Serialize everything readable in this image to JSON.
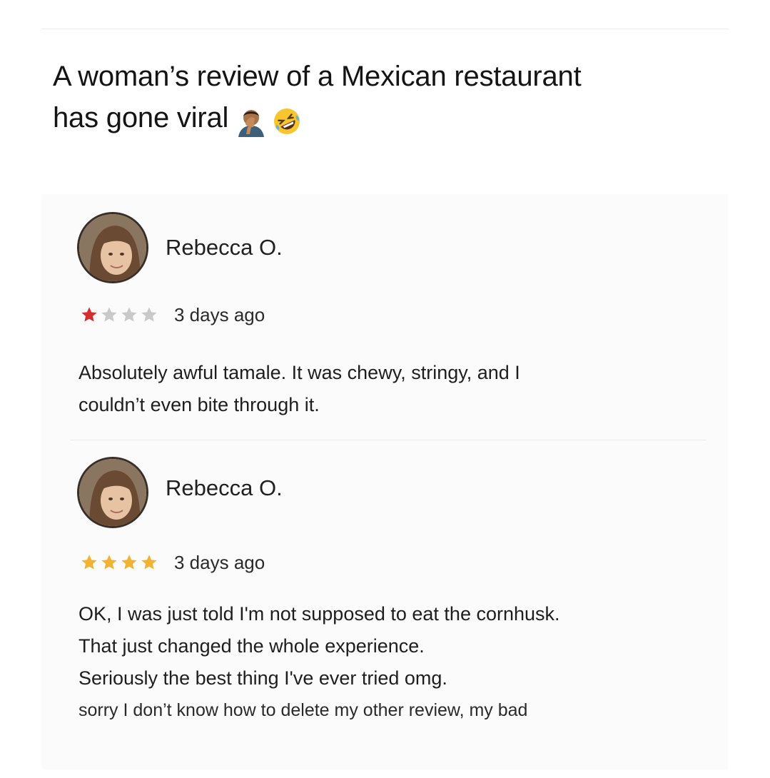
{
  "post": {
    "headline_line1": "A woman’s review of a Mexican restaurant",
    "headline_line2": "has gone viral",
    "emojis": [
      "man-facepalming-icon",
      "rolling-on-floor-laughing-icon"
    ]
  },
  "reviews": [
    {
      "reviewer": "Rebecca O.",
      "rating": 1,
      "max_rating": 4,
      "date": "3 days ago",
      "star_color": "#d32f2f",
      "lines": [
        "Absolutely awful tamale. It was chewy, stringy, and I",
        "couldn’t even bite through it."
      ]
    },
    {
      "reviewer": "Rebecca O.",
      "rating": 4,
      "max_rating": 4,
      "date": "3 days ago",
      "star_color": "#f2b233",
      "lines": [
        "OK, I was just told I'm not supposed to eat the cornhusk.",
        "That just changed the whole experience.",
        "Seriously the best thing I've ever tried omg.",
        "sorry I don’t know how to delete my other review, my bad"
      ]
    }
  ],
  "colors": {
    "empty_star": "#c9c9c9",
    "card_background": "#fbfbfb"
  }
}
